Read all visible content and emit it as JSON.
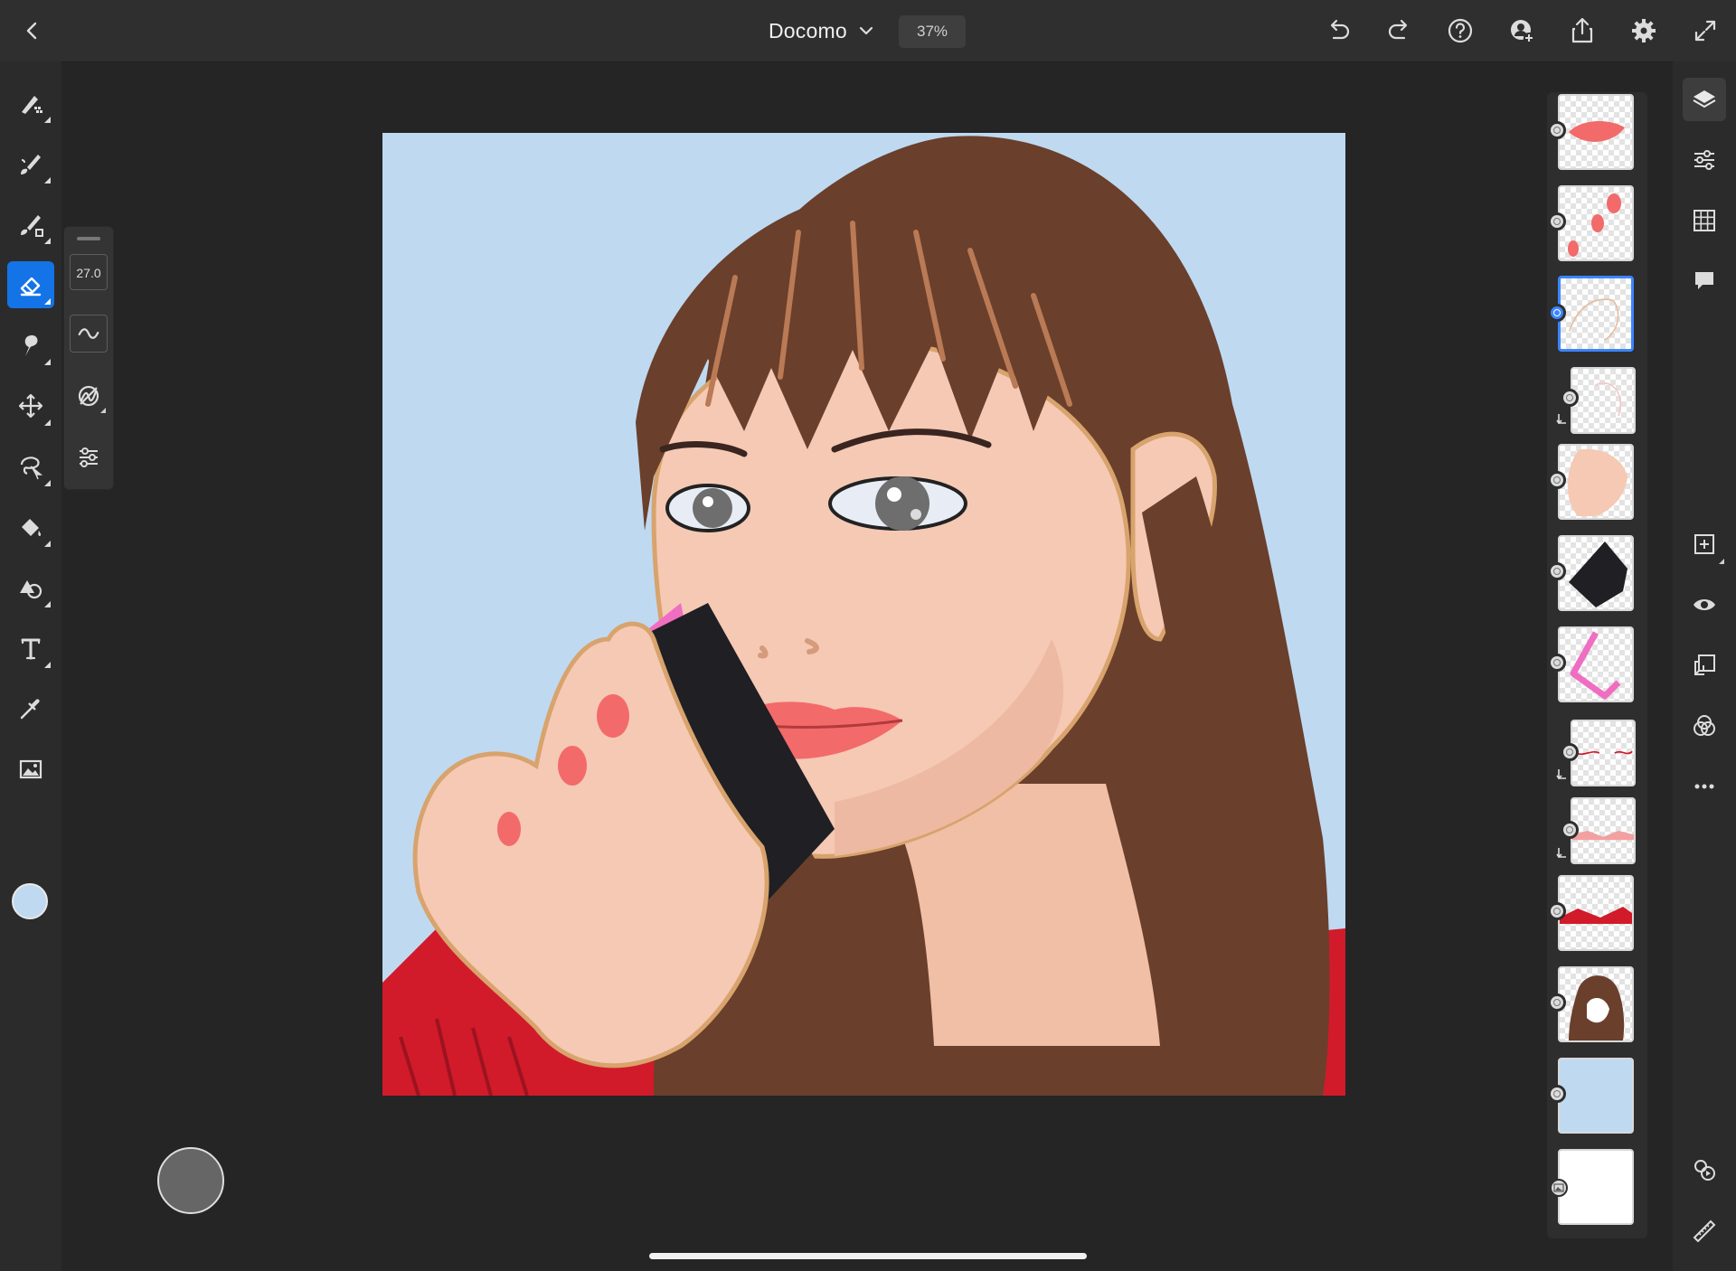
{
  "app": {
    "document_title": "Docomo",
    "zoom_level": "37%"
  },
  "topbar": {
    "icons": [
      "back-icon",
      "chevron-down-icon",
      "undo-icon",
      "redo-icon",
      "help-icon",
      "invite-icon",
      "share-icon",
      "settings-icon",
      "fullscreen-icon"
    ]
  },
  "toolbar": {
    "tools": [
      "pixel-brush",
      "live-brush",
      "vector-brush",
      "eraser",
      "smudge",
      "move",
      "selection",
      "fill",
      "shape",
      "text",
      "eyedropper",
      "place-image"
    ],
    "active_tool": "eraser",
    "current_color": "#bfd9f1"
  },
  "tool_options": {
    "eraser_size": "27.0"
  },
  "layers": {
    "count": 13,
    "selected_index": 3
  },
  "colors": {
    "accent": "#1473e6",
    "sky": "#bfd9f1",
    "hair": "#6a3f2b",
    "skin": "#f5c9b4",
    "sweater": "#d11b2a",
    "phone": "#f06ec2",
    "lips": "#f36a6a"
  }
}
